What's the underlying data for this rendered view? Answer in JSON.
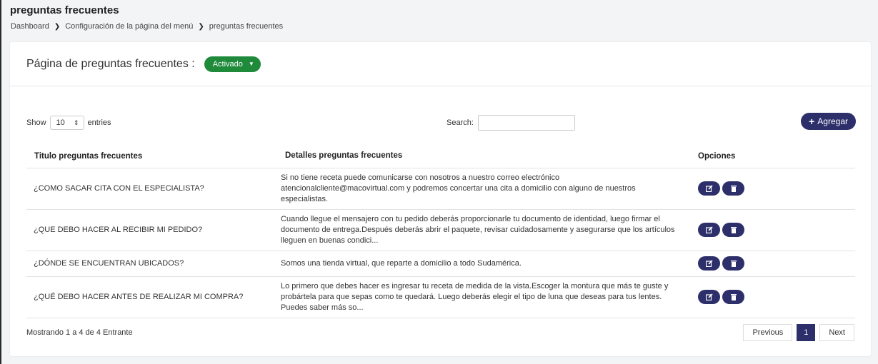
{
  "page": {
    "title": "preguntas frecuentes"
  },
  "breadcrumb": [
    "Dashboard",
    "Configuración de la página del menú",
    "preguntas frecuentes"
  ],
  "header": {
    "label": "Página de preguntas frecuentes :",
    "status": "Activado",
    "status_color": "#1e8a3a"
  },
  "controls": {
    "show_label": "Show",
    "entries_value": "10",
    "entries_label": "entries",
    "search_label": "Search:",
    "search_value": "",
    "add_label": "Agregar"
  },
  "table": {
    "headers": [
      "Titulo preguntas frecuentes",
      "Detalles preguntas frecuentes",
      "Opciones"
    ],
    "rows": [
      {
        "title": "¿COMO SACAR CITA CON EL ESPECIALISTA?",
        "detail": "Si no tiene receta puede comunicarse con nosotros a nuestro correo electrónico atencionalcliente@macovirtual.com y podremos concertar una cita a domicilio con alguno de nuestros especialistas."
      },
      {
        "title": "¿QUE DEBO HACER AL RECIBIR MI PEDIDO?",
        "detail": "Cuando llegue el mensajero con tu pedido deberás proporcionarle tu documento de identidad, luego firmar el documento de entrega.Después deberás abrir el paquete, revisar cuidadosamente y asegurarse que los artículos lleguen en buenas condici..."
      },
      {
        "title": "¿DÓNDE SE ENCUENTRAN UBICADOS?",
        "detail": "Somos una tienda virtual, que reparte a domicilio a todo Sudamérica."
      },
      {
        "title": "¿QUÉ DEBO HACER ANTES DE REALIZAR MI COMPRA?",
        "detail": "Lo primero que debes hacer es ingresar tu receta de medida de la vista.Escoger la montura que más te guste y probártela para que sepas como te quedará.  Luego deberás elegir el tipo de luna que deseas para tus lentes. Puedes saber más so..."
      }
    ]
  },
  "footer": {
    "info": "Mostrando 1 a 4 de 4 Entrante",
    "prev": "Previous",
    "page": "1",
    "next": "Next"
  },
  "colors": {
    "primary": "#2d2f6b",
    "success": "#1e8a3a"
  }
}
